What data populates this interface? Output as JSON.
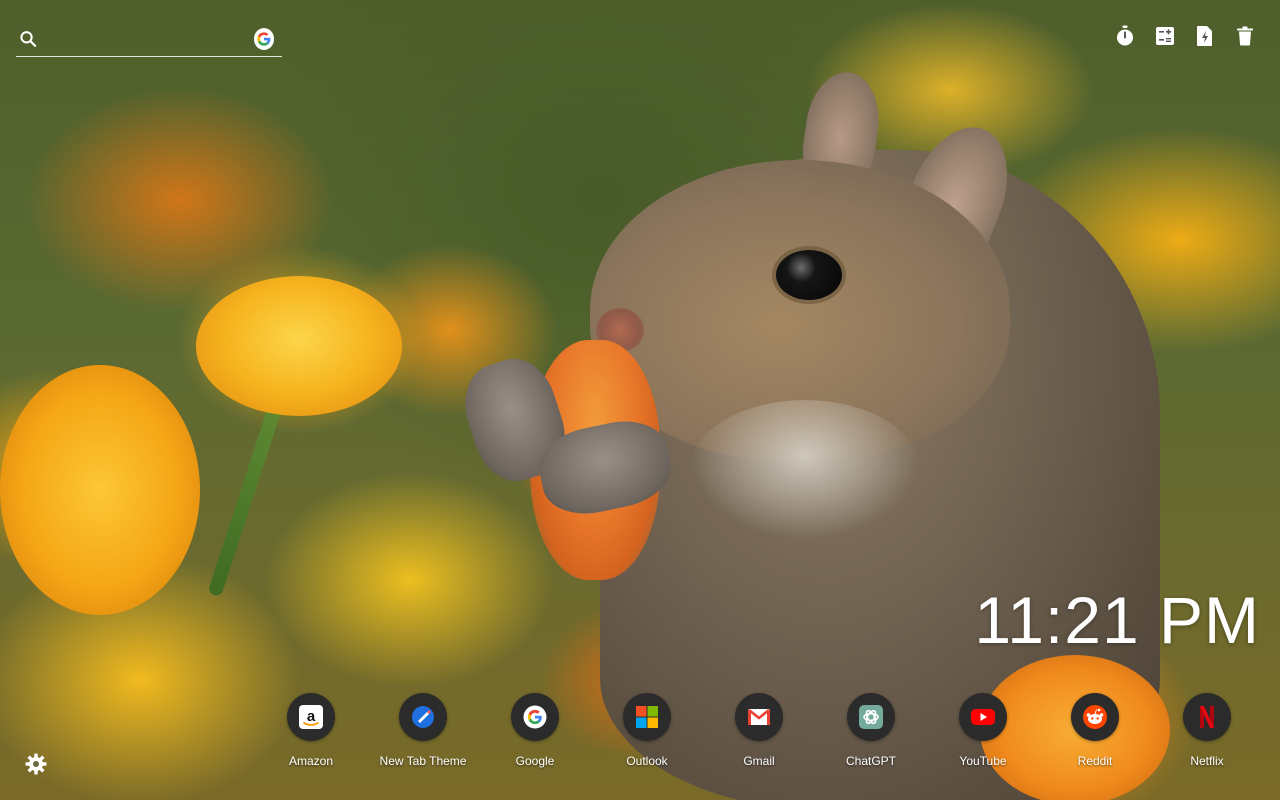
{
  "search": {
    "placeholder": "",
    "engine_icon": "google-g-icon",
    "search_icon": "magnifier-icon"
  },
  "toolbar": {
    "items": [
      {
        "icon": "stopwatch-icon"
      },
      {
        "icon": "calculator-icon"
      },
      {
        "icon": "document-bolt-icon"
      },
      {
        "icon": "trash-icon"
      }
    ]
  },
  "clock": {
    "time": "11:21 PM"
  },
  "shortcuts": [
    {
      "label": "Amazon",
      "icon": "amazon-icon",
      "color": "#ffffff"
    },
    {
      "label": "New Tab Theme",
      "icon": "new-tab-theme-icon",
      "color": "#1e6fe0"
    },
    {
      "label": "Google",
      "icon": "google-icon",
      "color": "#ffffff"
    },
    {
      "label": "Outlook",
      "icon": "microsoft-icon",
      "color": "#f25022"
    },
    {
      "label": "Gmail",
      "icon": "gmail-icon",
      "color": "#ea4335"
    },
    {
      "label": "ChatGPT",
      "icon": "chatgpt-icon",
      "color": "#74aa9c"
    },
    {
      "label": "YouTube",
      "icon": "youtube-icon",
      "color": "#ff0000"
    },
    {
      "label": "Reddit",
      "icon": "reddit-icon",
      "color": "#ff4500"
    },
    {
      "label": "Netflix",
      "icon": "netflix-icon",
      "color": "#e50914"
    }
  ],
  "settings": {
    "icon": "gear-icon"
  }
}
